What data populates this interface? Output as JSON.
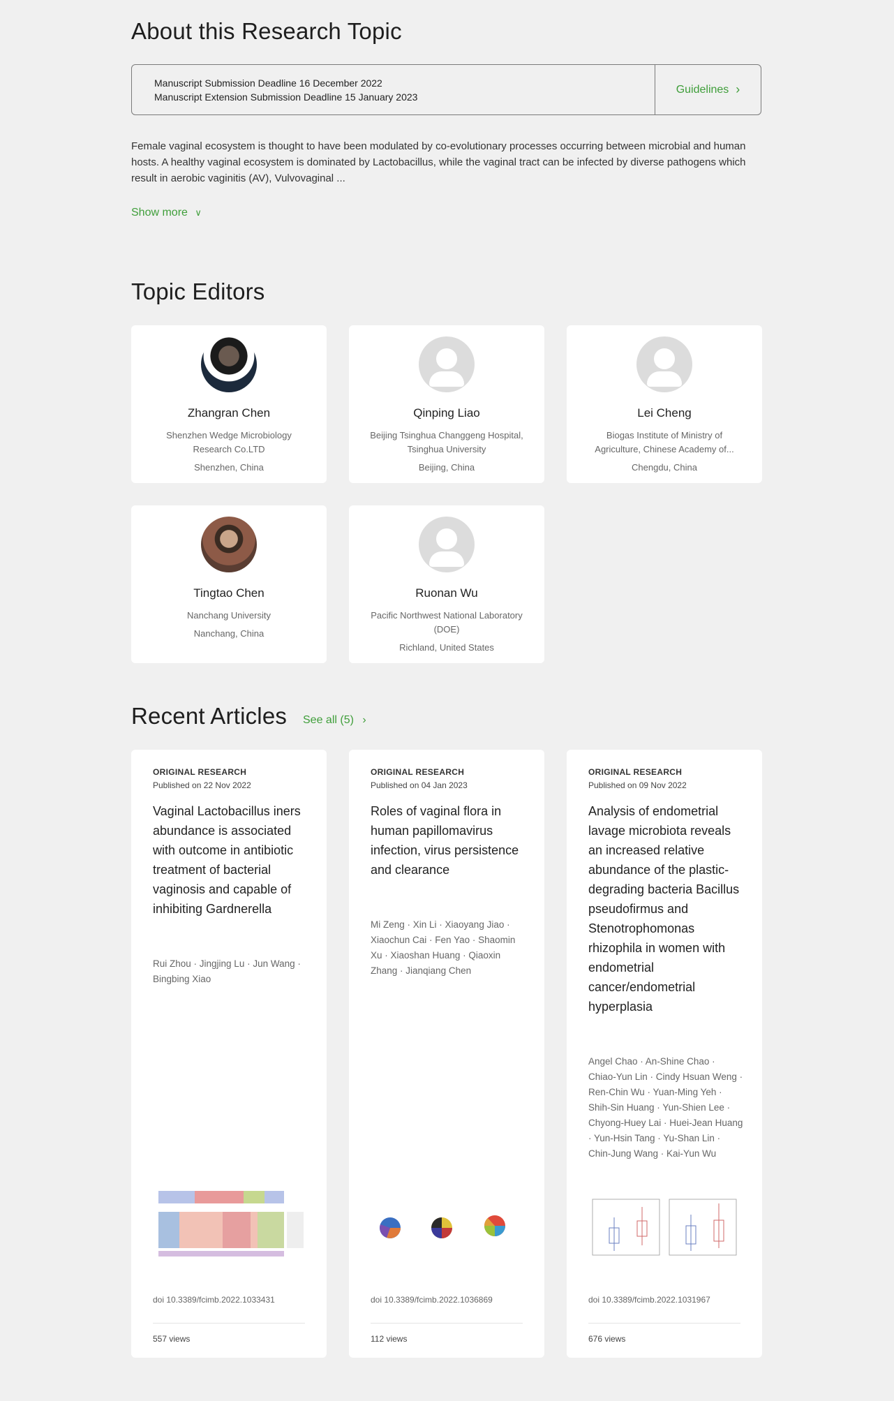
{
  "about": {
    "title": "About this Research Topic",
    "deadline_line1": "Manuscript Submission Deadline 16 December 2022",
    "deadline_line2": "Manuscript Extension Submission Deadline 15 January 2023",
    "guidelines_label": "Guidelines",
    "body": "Female vaginal ecosystem is thought to have been modulated by co-evolutionary processes occurring between microbial and human hosts. A healthy vaginal ecosystem is dominated by Lactobacillus, while the vaginal tract can be infected by diverse pathogens which result in aerobic vaginitis (AV), Vulvovaginal ...",
    "show_more_label": "Show more"
  },
  "editors": {
    "title": "Topic Editors",
    "items": [
      {
        "name": "Zhangran Chen",
        "affiliation": "Shenzhen Wedge Microbiology Research Co.LTD",
        "location": "Shenzhen, China",
        "avatar": "photo"
      },
      {
        "name": "Qinping Liao",
        "affiliation": "Beijing Tsinghua Changgeng Hospital, Tsinghua University",
        "location": "Beijing, China",
        "avatar": "placeholder"
      },
      {
        "name": "Lei Cheng",
        "affiliation": "Biogas Institute of Ministry of Agriculture, Chinese Academy of...",
        "location": "Chengdu, China",
        "avatar": "placeholder"
      },
      {
        "name": "Tingtao Chen",
        "affiliation": "Nanchang University",
        "location": "Nanchang, China",
        "avatar": "photo"
      },
      {
        "name": "Ruonan Wu",
        "affiliation": "Pacific Northwest National Laboratory (DOE)",
        "location": "Richland, United States",
        "avatar": "placeholder"
      }
    ]
  },
  "articles": {
    "title": "Recent Articles",
    "see_all_label": "See all (5)",
    "items": [
      {
        "type": "ORIGINAL RESEARCH",
        "published": "Published on 22 Nov 2022",
        "title": "Vaginal Lactobacillus iners abundance is associated with outcome in antibiotic treatment of bacterial vaginosis and capable of inhibiting Gardnerella",
        "authors": "Rui Zhou · Jingjing Lu · Jun Wang · Bingbing Xiao",
        "doi": "doi 10.3389/fcimb.2022.1033431",
        "views": "557 views",
        "thumb": "stacked-bars"
      },
      {
        "type": "ORIGINAL RESEARCH",
        "published": "Published on 04 Jan 2023",
        "title": "Roles of vaginal flora in human papillomavirus infection, virus persistence and clearance",
        "authors": "Mi Zeng · Xin Li · Xiaoyang Jiao · Xiaochun Cai · Fen Yao · Shaomin Xu · Xiaoshan Huang · Qiaoxin Zhang · Jianqiang Chen",
        "doi": "doi 10.3389/fcimb.2022.1036869",
        "views": "112 views",
        "thumb": "pies"
      },
      {
        "type": "ORIGINAL RESEARCH",
        "published": "Published on 09 Nov 2022",
        "title": "Analysis of endometrial lavage microbiota reveals an increased relative abundance of the plastic-degrading bacteria Bacillus pseudofirmus and Stenotrophomonas rhizophila in women with endometrial cancer/endometrial hyperplasia",
        "authors": "Angel Chao · An-Shine Chao · Chiao-Yun Lin · Cindy Hsuan Weng · Ren-Chin Wu · Yuan-Ming Yeh · Shih-Sin Huang · Yun-Shien Lee · Chyong-Huey Lai · Huei-Jean Huang · Yun-Hsin Tang · Yu-Shan Lin · Chin-Jung Wang · Kai-Yun Wu",
        "doi": "doi 10.3389/fcimb.2022.1031967",
        "views": "676 views",
        "thumb": "boxplots"
      }
    ]
  },
  "colors": {
    "accent": "#3f9e3a",
    "background": "#f0f0f0",
    "card": "#ffffff"
  }
}
